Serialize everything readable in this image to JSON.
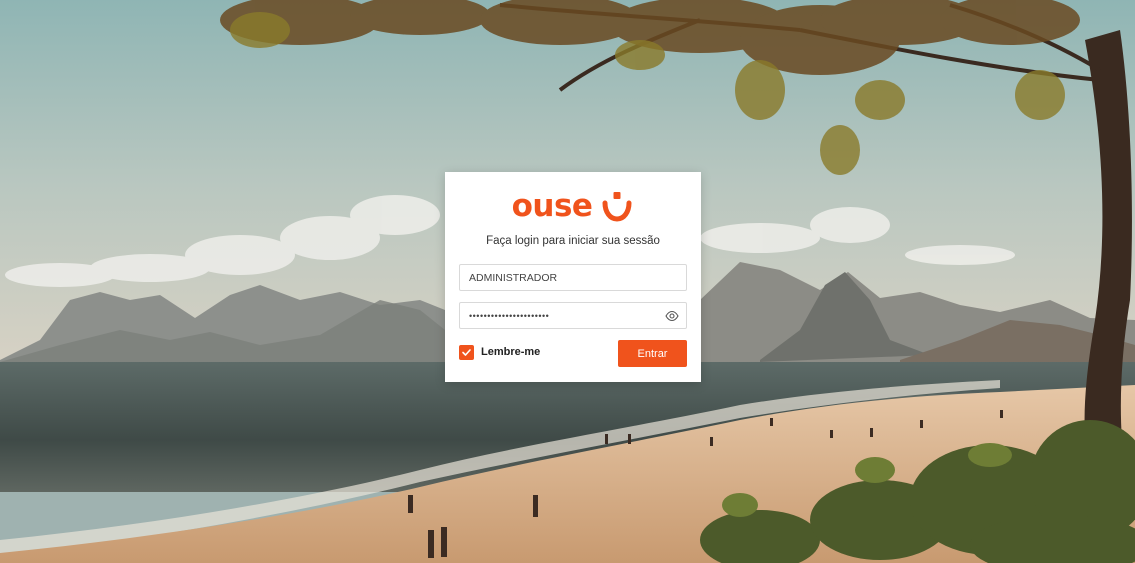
{
  "brand": {
    "name": "ouse",
    "accent_color": "#f0531c",
    "logo_icon": "smile-icon"
  },
  "login": {
    "subtitle": "Faça login para iniciar sua sessão",
    "username_value": "ADMINISTRADOR",
    "password_value": "••••••••••••••••••••••",
    "password_toggle_icon": "eye-icon",
    "remember_label": "Lembre-me",
    "remember_checked": true,
    "submit_label": "Entrar"
  }
}
